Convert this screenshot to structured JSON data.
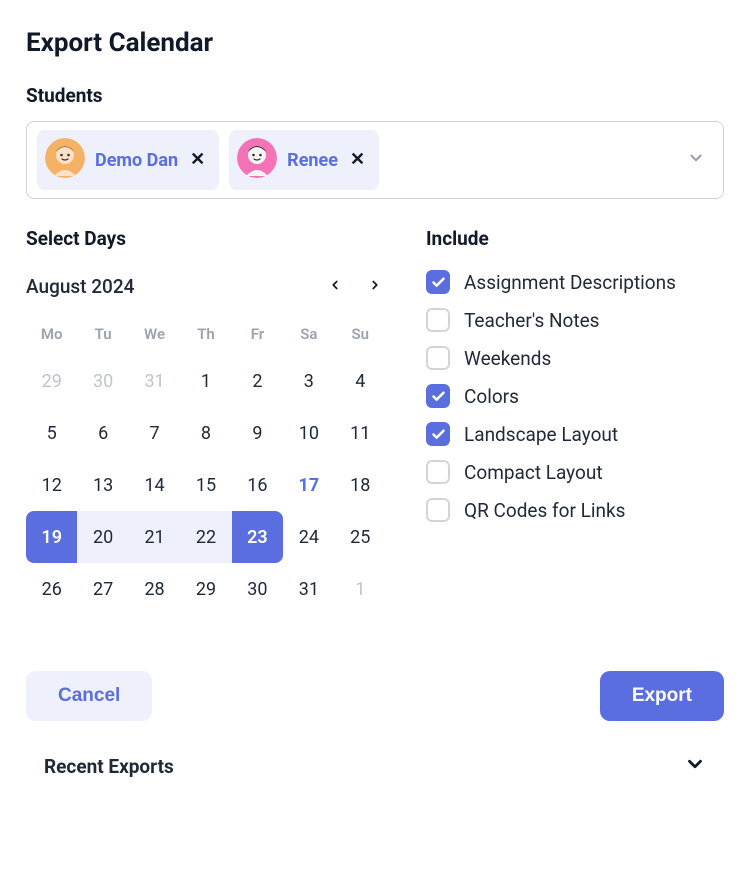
{
  "title": "Export Calendar",
  "students": {
    "label": "Students",
    "chips": [
      {
        "name": "Demo Dan",
        "avatar_bg": "#f4b266",
        "hair": "#9b6a3c",
        "face": "#fde2c5"
      },
      {
        "name": "Renee",
        "avatar_bg": "#f472b6",
        "hair": "#111111",
        "face": "#f5f5f5"
      }
    ]
  },
  "calendar": {
    "label": "Select Days",
    "month_label": "August 2024",
    "dow": [
      "Mo",
      "Tu",
      "We",
      "Th",
      "Fr",
      "Sa",
      "Su"
    ],
    "today": 17,
    "range_start": 19,
    "range_end": 23,
    "cells": [
      {
        "n": 29,
        "outside": true
      },
      {
        "n": 30,
        "outside": true
      },
      {
        "n": 31,
        "outside": true
      },
      {
        "n": 1
      },
      {
        "n": 2
      },
      {
        "n": 3
      },
      {
        "n": 4
      },
      {
        "n": 5
      },
      {
        "n": 6
      },
      {
        "n": 7
      },
      {
        "n": 8
      },
      {
        "n": 9
      },
      {
        "n": 10
      },
      {
        "n": 11
      },
      {
        "n": 12
      },
      {
        "n": 13
      },
      {
        "n": 14
      },
      {
        "n": 15
      },
      {
        "n": 16
      },
      {
        "n": 17
      },
      {
        "n": 18
      },
      {
        "n": 19
      },
      {
        "n": 20
      },
      {
        "n": 21
      },
      {
        "n": 22
      },
      {
        "n": 23
      },
      {
        "n": 24
      },
      {
        "n": 25
      },
      {
        "n": 26
      },
      {
        "n": 27
      },
      {
        "n": 28
      },
      {
        "n": 29
      },
      {
        "n": 30
      },
      {
        "n": 31
      },
      {
        "n": 1,
        "outside": true
      }
    ]
  },
  "include": {
    "label": "Include",
    "options": [
      {
        "label": "Assignment Descriptions",
        "checked": true
      },
      {
        "label": "Teacher's Notes",
        "checked": false
      },
      {
        "label": "Weekends",
        "checked": false
      },
      {
        "label": "Colors",
        "checked": true
      },
      {
        "label": "Landscape Layout",
        "checked": true
      },
      {
        "label": "Compact Layout",
        "checked": false
      },
      {
        "label": "QR Codes for Links",
        "checked": false
      }
    ]
  },
  "footer": {
    "cancel": "Cancel",
    "export": "Export"
  },
  "recent": {
    "label": "Recent Exports"
  }
}
